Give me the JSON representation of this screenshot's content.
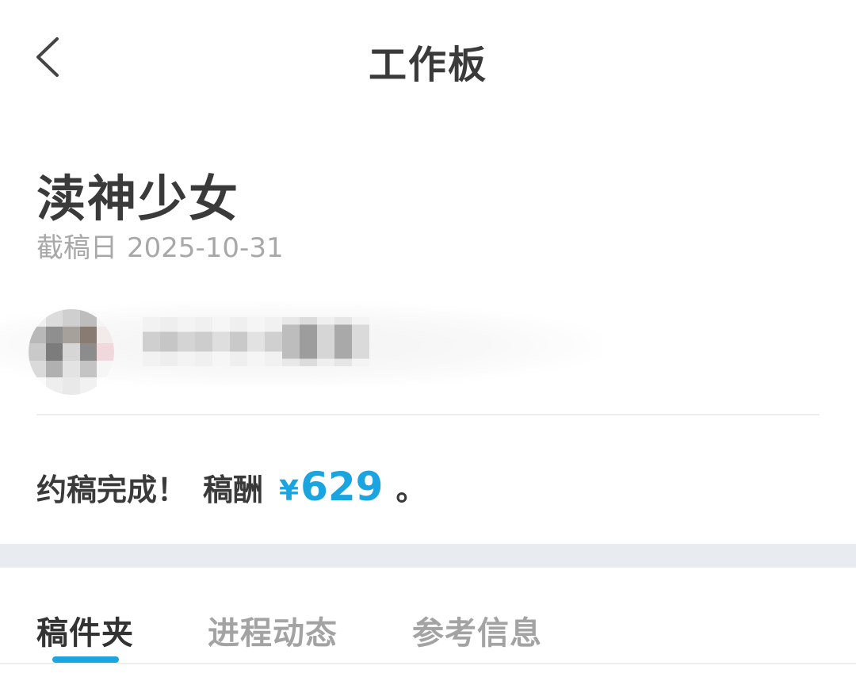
{
  "header": {
    "title": "工作板",
    "back_icon": "chevron-left-icon"
  },
  "work": {
    "title": "渎神少女",
    "deadline_label": "截稿日",
    "deadline_date": "2025-10-31"
  },
  "user": {
    "avatar_icon": "avatar-blurred"
  },
  "status": {
    "message": "约稿完成！",
    "fee_label": "稿酬",
    "currency": "¥",
    "amount": "629",
    "period": "。",
    "accent_color": "#1aa5e0"
  },
  "tabs": [
    {
      "label": "稿件夹",
      "active": true
    },
    {
      "label": "进程动态",
      "active": false
    },
    {
      "label": "参考信息",
      "active": false
    }
  ]
}
